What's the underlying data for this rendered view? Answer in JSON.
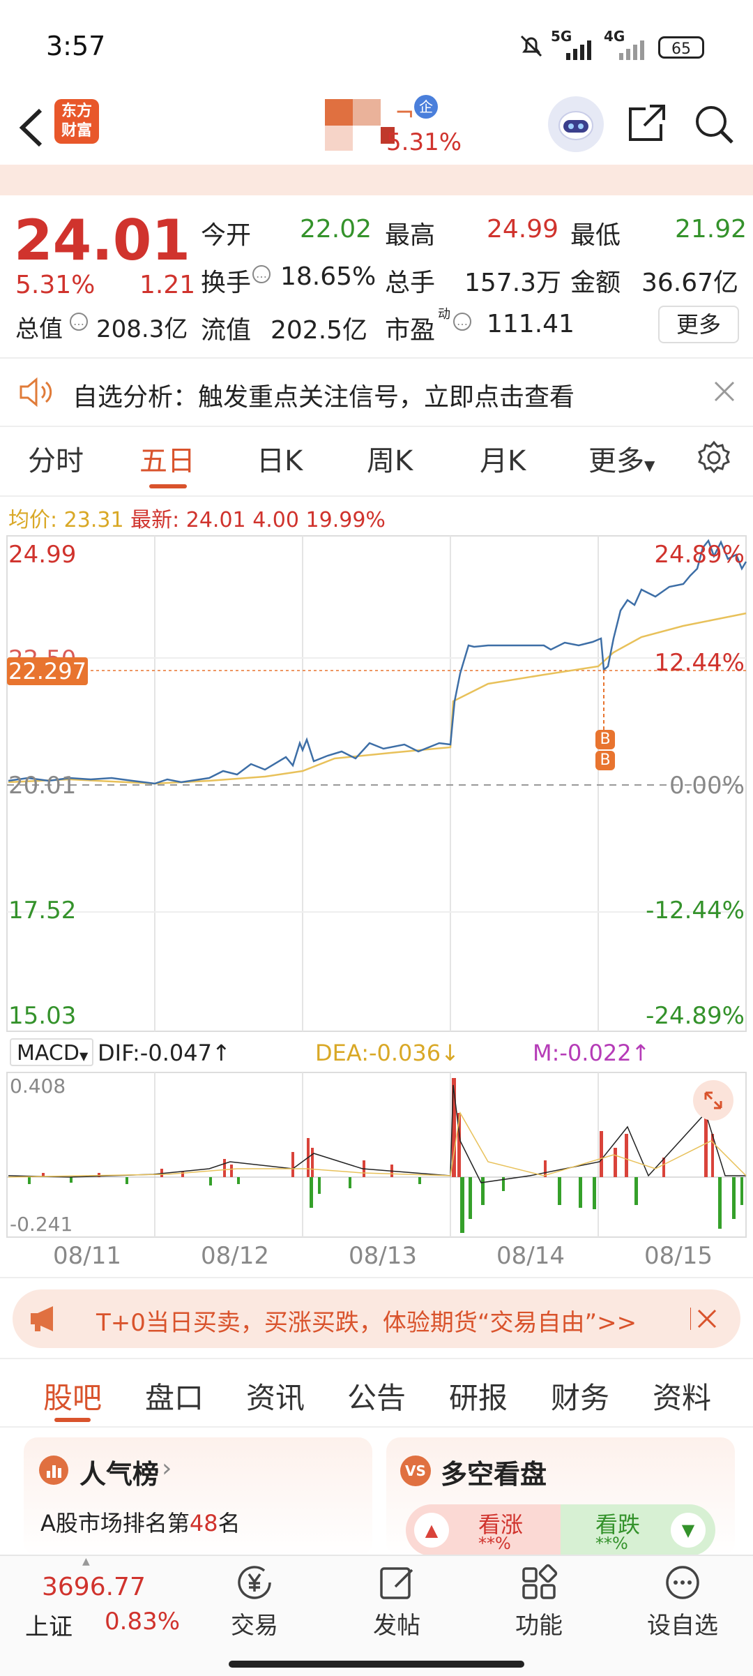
{
  "status_bar": {
    "time": "3:57",
    "network1": "5G",
    "network2": "4G",
    "battery": "65"
  },
  "header": {
    "logo_line1": "东方",
    "logo_line2": "财富",
    "stock_badge": "企",
    "stock_change": "5.31%"
  },
  "quote": {
    "price": "24.01",
    "change_pct": "5.31%",
    "change_amt": "1.21",
    "open_label": "今开",
    "open": "22.02",
    "high_label": "最高",
    "high": "24.99",
    "low_label": "最低",
    "low": "21.92",
    "turnover_label": "换手",
    "turnover": "18.65%",
    "volume_label": "总手",
    "volume": "157.3万",
    "amount_label": "金额",
    "amount": "36.67亿",
    "mktcap_label": "总值",
    "mktcap": "208.3亿",
    "float_label": "流值",
    "float_cap": "202.5亿",
    "pe_label": "市盈",
    "pe_sup": "动",
    "pe": "111.41",
    "more_button": "更多"
  },
  "notice": {
    "text": "自选分析：触发重点关注信号，立即点击查看"
  },
  "chart_tabs": [
    "分时",
    "五日",
    "日K",
    "周K",
    "月K",
    "更多"
  ],
  "chart_header": {
    "avg_label": "均价:",
    "avg": "23.31",
    "latest_label": "最新:",
    "latest": "24.01",
    "chg": "4.00",
    "pct": "19.99%"
  },
  "price_chart": {
    "y_left": [
      "24.99",
      "22.50",
      "20.01",
      "17.52",
      "15.03"
    ],
    "y_right": [
      "24.89%",
      "12.44%",
      "0.00%",
      "-12.44%",
      "-24.89%"
    ],
    "crosshair": "22.297",
    "markers": [
      "B",
      "B"
    ]
  },
  "macd": {
    "selector": "MACD",
    "dif": "DIF:-0.047↑",
    "dea": "DEA:-0.036↓",
    "m": "M:-0.022↑",
    "ymax": "0.408",
    "ymin": "-0.241"
  },
  "dates": [
    "08/11",
    "08/12",
    "08/13",
    "08/14",
    "08/15"
  ],
  "chart_data": {
    "type": "line",
    "x": [
      "08/11",
      "08/12",
      "08/13",
      "08/14",
      "08/15"
    ],
    "ylim": [
      15.03,
      24.99
    ],
    "series": [
      {
        "name": "最新",
        "values": [
          20.1,
          20.3,
          20.9,
          23.0,
          24.01
        ]
      },
      {
        "name": "均价",
        "values": [
          20.05,
          20.1,
          20.6,
          22.3,
          23.31
        ]
      }
    ]
  },
  "promo": {
    "text": "T+0当日买卖，买涨买跌，体验期货“交易自由”>>"
  },
  "bottom_tabs": [
    "股吧",
    "盘口",
    "资讯",
    "公告",
    "研报",
    "财务",
    "资料"
  ],
  "cards": {
    "popularity_title": "人气榜",
    "popularity_rank_pre": "A股市场排名第",
    "popularity_rank": "48",
    "popularity_rank_post": "名",
    "vs_title": "多空看盘",
    "bull": "看涨",
    "bear": "看跌",
    "bull_pct": "**%",
    "bear_pct": "**%"
  },
  "bottom_nav": {
    "index_value": "3696.77",
    "index_name": "上证",
    "index_change": "0.83%",
    "trade": "交易",
    "post": "发帖",
    "func": "功能",
    "add": "设自选"
  }
}
